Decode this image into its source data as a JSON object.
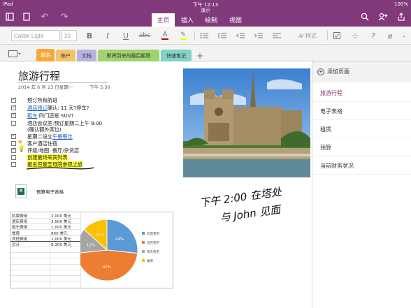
{
  "status": {
    "device": "iPad",
    "time": "下午 12:13",
    "battery": "100%"
  },
  "title_bar": {
    "doc_title": "演示"
  },
  "tabs": [
    {
      "label": "主页",
      "active": true
    },
    {
      "label": "插入",
      "active": false
    },
    {
      "label": "绘制",
      "active": false
    },
    {
      "label": "视图",
      "active": false
    }
  ],
  "ribbon": {
    "font_name": "Calibri Light",
    "font_size": "20",
    "style_label": "样式"
  },
  "sections": [
    {
      "label": "旅游",
      "color": "#f7a839"
    },
    {
      "label": "帐户",
      "color": "#f4c26b"
    },
    {
      "label": "文档",
      "color": "#b6b2e0"
    },
    {
      "label": "即将到来的最后期限",
      "color": "#9fd36e"
    },
    {
      "label": "快速笔记",
      "color": "#81d3c7"
    }
  ],
  "page_panel": {
    "add_label": "添加页面",
    "pages": [
      {
        "label": "旅游行程",
        "selected": true
      },
      {
        "label": "电子表格",
        "selected": false
      },
      {
        "label": "租赁",
        "selected": false
      },
      {
        "label": "预算",
        "selected": false
      },
      {
        "label": "当前财务状况",
        "selected": false
      }
    ]
  },
  "note": {
    "title": "旅游行程",
    "date": "2014 年 6 月 23 日星期一",
    "time": "下午 5:36",
    "todos": {
      "t1": "预订所有航班",
      "t2_link": "酒店预订",
      "t2_rest": "确认: 11 天?停车?",
      "t3_link": "租车",
      "t3_rest": ":四门还是 SUV?",
      "t4": "酒店会议室:预订星期二上午 9:00",
      "t4b": "(确认额外席位)",
      "t5_pre": "星期二设立",
      "t5_link": "午餐餐饮",
      "t6": "客户酒店住宿",
      "t7": "评级/地图: 餐厅/杂货店",
      "t8": "创建最终来宾列表",
      "t9": "报名巴黎圣母院参观之旅"
    },
    "attachment": "预算电子表格",
    "ink_line1": "下午 2:00 在塔处",
    "ink_line2": "与 John 见面"
  },
  "sheet": {
    "rows": [
      {
        "label": "机票费用",
        "value": "2,000 美元"
      },
      {
        "label": "酒店费用",
        "value": "3,500 美元"
      },
      {
        "label": "租车费用",
        "value": "1,000 美元"
      },
      {
        "label": "餐费",
        "value": "800 美元"
      },
      {
        "label": "其他费用",
        "value": "1,000 美元"
      },
      {
        "label": "总计",
        "value": "8,300 美元"
      }
    ]
  },
  "chart_data": {
    "type": "pie",
    "labels": [
      "机票费用",
      "酒店费用",
      "租车费用",
      "餐费"
    ],
    "values": [
      24,
      42,
      12,
      12
    ],
    "data_labels": [
      "24%",
      "42%",
      "12%",
      "12%"
    ],
    "colors": [
      "#5b9bd5",
      "#ed7d31",
      "#a5a5a5",
      "#ffc000"
    ],
    "legend_position": "right"
  }
}
